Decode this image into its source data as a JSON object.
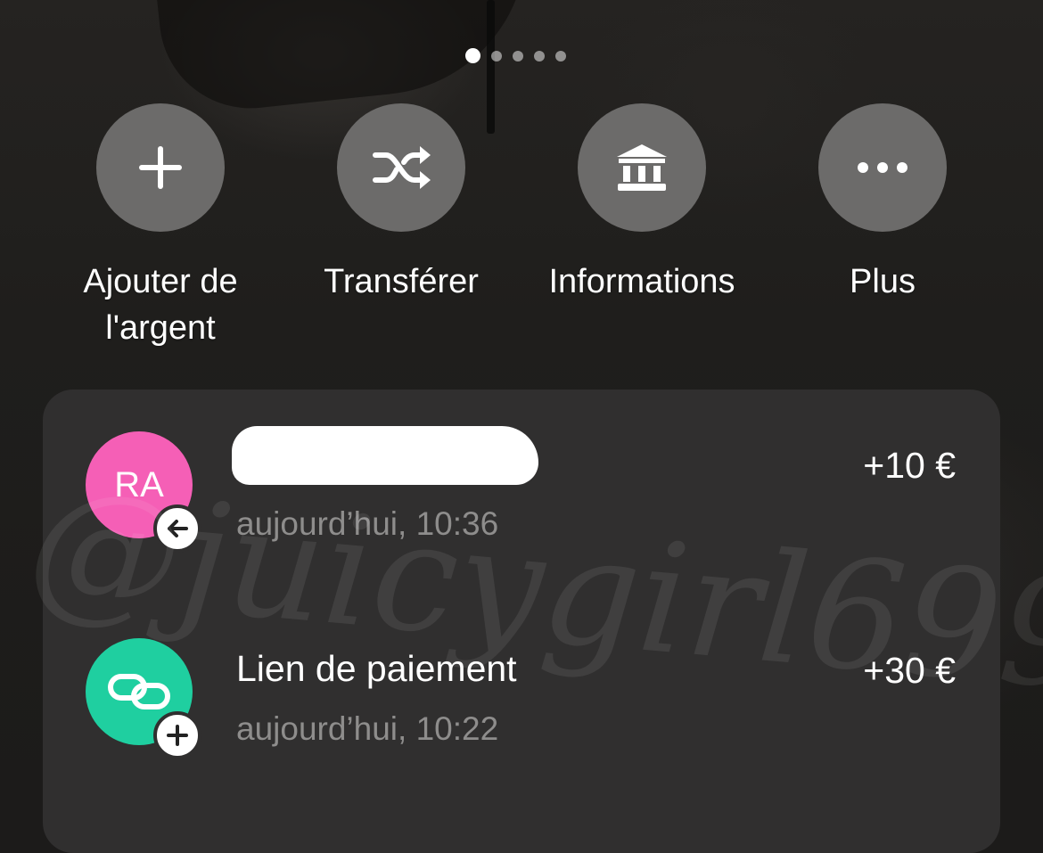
{
  "pager": {
    "count": 5,
    "active_index": 0
  },
  "actions": [
    {
      "id": "add",
      "label": "Ajouter de l'argent",
      "icon": "plus-icon"
    },
    {
      "id": "transfer",
      "label": "Transférer",
      "icon": "shuffle-icon"
    },
    {
      "id": "info",
      "label": "Informations",
      "icon": "bank-icon"
    },
    {
      "id": "more",
      "label": "Plus",
      "icon": "more-dots-icon"
    }
  ],
  "transactions": [
    {
      "avatar_initials": "RA",
      "avatar_color": "#f55fb6",
      "badge_icon": "arrow-left-icon",
      "title": "",
      "title_redacted": true,
      "time": "aujourd’hui, 10:36",
      "amount": "+10 €"
    },
    {
      "avatar_initials": "",
      "avatar_color": "#1fcfa0",
      "avatar_icon": "link-icon",
      "badge_icon": "plus-icon",
      "title": "Lien de paiement",
      "title_redacted": false,
      "time": "aujourd’hui, 10:22",
      "amount": "+30 €"
    }
  ],
  "watermark": "@juicygirl699"
}
